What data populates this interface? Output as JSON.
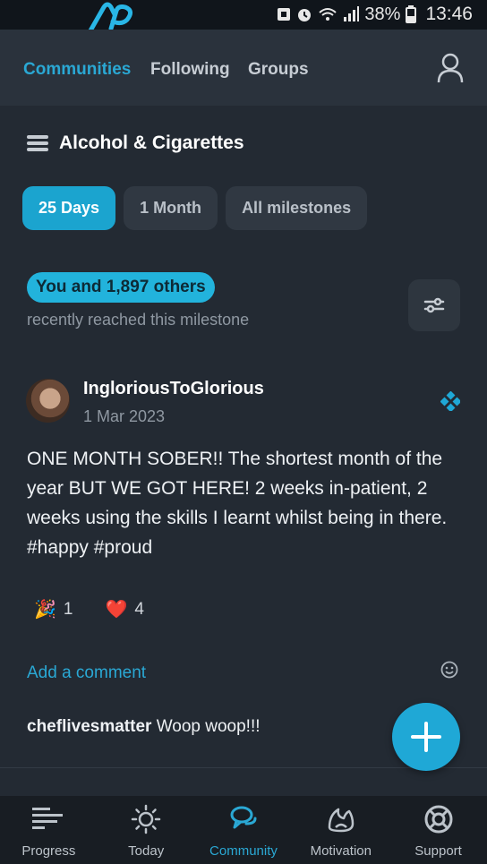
{
  "status_bar": {
    "battery": "38%",
    "time": "13:46"
  },
  "top_nav": {
    "tabs": [
      {
        "label": "Communities",
        "active": true
      },
      {
        "label": "Following",
        "active": false
      },
      {
        "label": "Groups",
        "active": false
      }
    ],
    "profile_icon": "user-icon"
  },
  "feed": {
    "title": "Alcohol & Cigarettes",
    "filters": [
      {
        "label": "25 Days",
        "active": true
      },
      {
        "label": "1 Month",
        "active": false
      },
      {
        "label": "All milestones",
        "active": false
      }
    ],
    "milestone_badge": "You and 1,897 others",
    "milestone_subtitle": "recently reached this milestone"
  },
  "post": {
    "author": "IngloriousToGlorious",
    "date": "1 Mar 2023",
    "body": "ONE MONTH SOBER!! The shortest month of the year BUT WE GOT HERE! 2 weeks in-patient, 2 weeks using the skills I learnt whilst being in there. #happy #proud",
    "reactions": [
      {
        "icon": "party-popper-icon",
        "emoji": "🎉",
        "count": "1"
      },
      {
        "icon": "heart-icon",
        "emoji": "❤️",
        "count": "4"
      }
    ],
    "add_comment": "Add a comment",
    "comment": {
      "user": "cheflivesmatter",
      "text": "Woop woop!!!"
    }
  },
  "bottom_nav": [
    {
      "label": "Progress",
      "icon": "progress-icon",
      "active": false
    },
    {
      "label": "Today",
      "icon": "sun-icon",
      "active": false
    },
    {
      "label": "Community",
      "icon": "community-icon",
      "active": true
    },
    {
      "label": "Motivation",
      "icon": "motivation-icon",
      "active": false
    },
    {
      "label": "Support",
      "icon": "lifebuoy-icon",
      "active": false
    }
  ],
  "colors": {
    "accent": "#1fa8d6",
    "background": "#232a33",
    "nav_background": "#2a323c",
    "bottom_nav_background": "#181d23"
  }
}
